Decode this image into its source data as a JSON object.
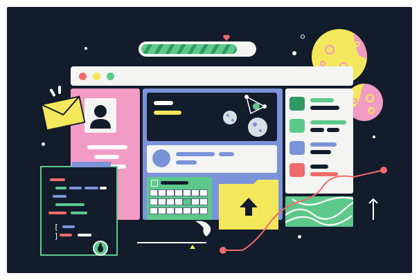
{
  "progress": {
    "level": 0.85
  },
  "folder": {
    "icon": "upload-arrow-icon"
  },
  "code_panel": {
    "bug_icon": "bug-icon",
    "brackets": "[ ]"
  },
  "icons": {
    "envelope": "envelope-icon",
    "avatar": "user-avatar-icon",
    "heart": "heart-icon",
    "arrow_up": "arrow-up-icon"
  },
  "colors": {
    "background": "#131c2b",
    "pink": "#f29bc4",
    "yellow": "#f3e85b",
    "green": "#5cc98b",
    "blue": "#7b93d8",
    "red": "#f06b6b",
    "dark": "#1c2434"
  }
}
